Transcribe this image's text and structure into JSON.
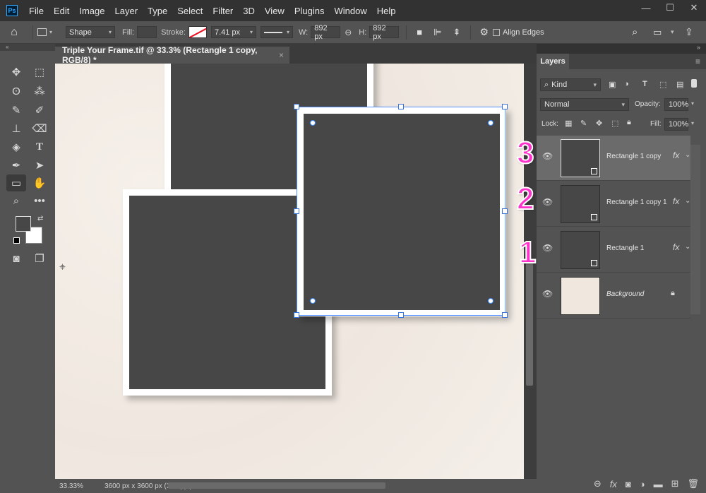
{
  "menubar": {
    "logo": "Ps",
    "items": [
      "File",
      "Edit",
      "Image",
      "Layer",
      "Type",
      "Select",
      "Filter",
      "3D",
      "View",
      "Plugins",
      "Window",
      "Help"
    ],
    "window_controls": [
      "—",
      "☐",
      "✕"
    ]
  },
  "options": {
    "tool_mode": "Shape",
    "fill_label": "Fill:",
    "stroke_label": "Stroke:",
    "stroke_width": "7.41 px",
    "w_label": "W:",
    "width": "892 px",
    "h_label": "H:",
    "height": "892 px",
    "align_edges_label": "Align Edges"
  },
  "document": {
    "tab_title": "Triple Your Frame.tif @ 33.3% (Rectangle 1 copy, RGB/8) *",
    "close": "×"
  },
  "statusbar": {
    "zoom": "33.33%",
    "doc_size": "3600 px x 3600 px (300 ppi)",
    "arrow": "›"
  },
  "layers_panel": {
    "tab_label": "Layers",
    "filter_kind": "Kind",
    "blend_mode": "Normal",
    "opacity_label": "Opacity:",
    "opacity_value": "100%",
    "lock_label": "Lock:",
    "fill_label": "Fill:",
    "fill_value": "100%",
    "layers": [
      {
        "name": "Rectangle 1 copy",
        "fx": "fx",
        "selected": true
      },
      {
        "name": "Rectangle 1 copy 1",
        "fx": "fx",
        "selected": false
      },
      {
        "name": "Rectangle 1",
        "fx": "fx",
        "selected": false
      },
      {
        "name": "Background",
        "locked": true,
        "selected": false
      }
    ]
  },
  "annotations": [
    "3",
    "2",
    "1"
  ],
  "colors": {
    "frame_inner": "#474747",
    "canvas_bg": "#f2ece6",
    "selection": "#4f8fff",
    "annotation": "#ff33cc"
  }
}
